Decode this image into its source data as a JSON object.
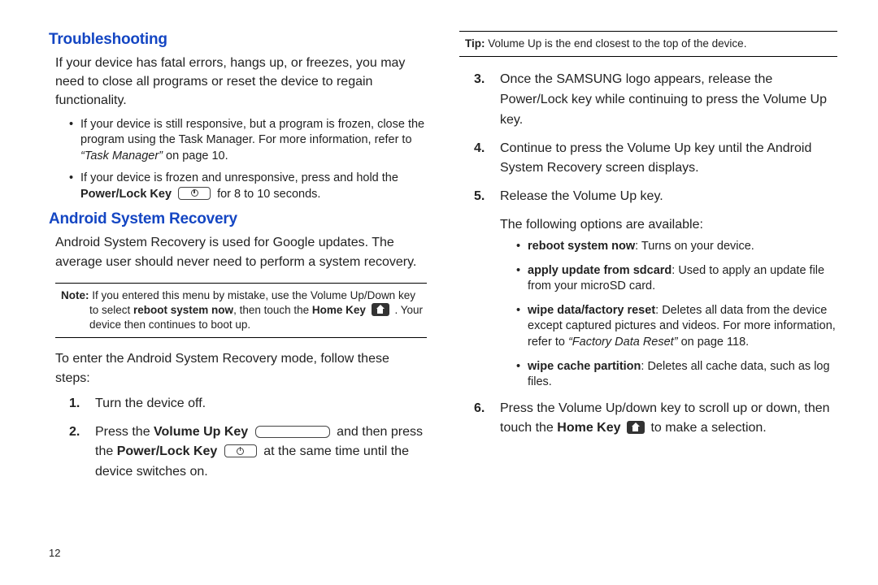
{
  "page_number": "12",
  "left": {
    "h1": "Troubleshooting",
    "p1": "If your device has fatal errors, hangs up, or freezes, you may need to close all programs or reset the device to regain functionality.",
    "bullet1_pre": "If your device is still responsive, but a program is frozen, close the program using the Task Manager. For more information, refer to ",
    "bullet1_ref": "“Task Manager”",
    "bullet1_post": "  on page 10.",
    "bullet2_pre": "If your device is frozen and unresponsive, press and hold the ",
    "bullet2_bold": "Power/Lock Key",
    "bullet2_post": " for 8 to 10 seconds.",
    "h2": "Android System Recovery",
    "p2": "Android System Recovery is used for Google updates. The average user should never need to perform a system recovery.",
    "note_label": "Note:",
    "note_pre": " If you entered this menu by mistake, use the Volume Up/Down key to select ",
    "note_bold1": "reboot system now",
    "note_mid": ", then touch the ",
    "note_bold2": "Home Key",
    "note_post": " . Your device then continues to boot up.",
    "p3": "To enter the Android System Recovery mode, follow these steps:",
    "steps": {
      "s1_num": "1.",
      "s1": "Turn the device off.",
      "s2_num": "2.",
      "s2_pre": "Press the ",
      "s2_b1": "Volume Up Key",
      "s2_mid": " and then press the ",
      "s2_b2": "Power/Lock Key",
      "s2_post": " at the same time until the device switches on."
    }
  },
  "right": {
    "tip_label": "Tip:",
    "tip_text": " Volume Up is the end closest to the top of the device.",
    "s3_num": "3.",
    "s3": "Once the SAMSUNG logo appears, release the Power/Lock key while continuing to press the Volume Up key.",
    "s4_num": "4.",
    "s4": "Continue to press the Volume Up key until the Android System Recovery screen displays.",
    "s5_num": "5.",
    "s5": "Release the Volume Up key.",
    "p_opts": "The following options are available:",
    "opt1_b": "reboot system now",
    "opt1_t": ": Turns on your device.",
    "opt2_b": "apply update from sdcard",
    "opt2_t": ": Used to apply an update file from your microSD card.",
    "opt3_b": "wipe data/factory reset",
    "opt3_t_pre": ": Deletes all data from the device except captured pictures and videos. For more information, refer to ",
    "opt3_ref": "“Factory Data Reset”",
    "opt3_t_post": "  on page 118.",
    "opt4_b": "wipe cache partition",
    "opt4_t": ": Deletes all cache data, such as log files.",
    "s6_num": "6.",
    "s6_pre": "Press the Volume Up/down key to scroll up or down, then touch the ",
    "s6_b": "Home Key",
    "s6_post": " to make a selection."
  }
}
